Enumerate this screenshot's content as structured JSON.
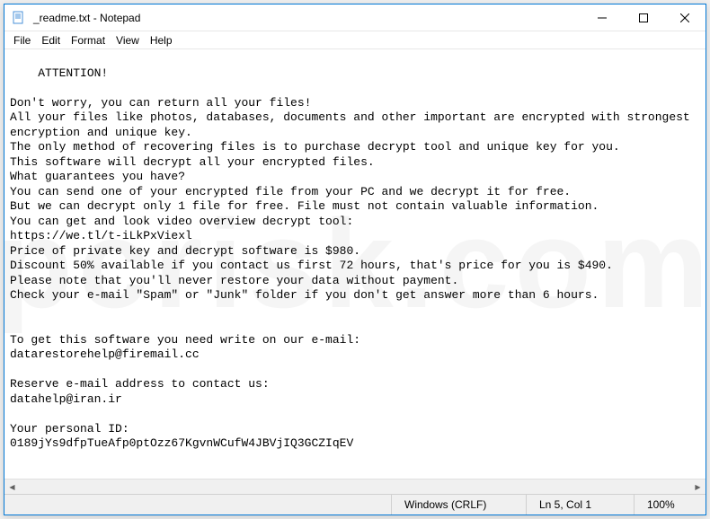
{
  "window": {
    "title": "_readme.txt - Notepad"
  },
  "menu": {
    "file": "File",
    "edit": "Edit",
    "format": "Format",
    "view": "View",
    "help": "Help"
  },
  "document": {
    "text": "ATTENTION!\n\nDon't worry, you can return all your files!\nAll your files like photos, databases, documents and other important are encrypted with strongest encryption and unique key.\nThe only method of recovering files is to purchase decrypt tool and unique key for you.\nThis software will decrypt all your encrypted files.\nWhat guarantees you have?\nYou can send one of your encrypted file from your PC and we decrypt it for free.\nBut we can decrypt only 1 file for free. File must not contain valuable information.\nYou can get and look video overview decrypt tool:\nhttps://we.tl/t-iLkPxViexl\nPrice of private key and decrypt software is $980.\nDiscount 50% available if you contact us first 72 hours, that's price for you is $490.\nPlease note that you'll never restore your data without payment.\nCheck your e-mail \"Spam\" or \"Junk\" folder if you don't get answer more than 6 hours.\n\n\nTo get this software you need write on our e-mail:\ndatarestorehelp@firemail.cc\n\nReserve e-mail address to contact us:\ndatahelp@iran.ir\n\nYour personal ID:\n0189jYs9dfpTueAfp0ptOzz67KgvnWCufW4JBVjIQ3GCZIqEV"
  },
  "status": {
    "encoding": "Windows (CRLF)",
    "position": "Ln 5, Col 1",
    "zoom": "100%"
  },
  "watermark": "pcrisk.com"
}
